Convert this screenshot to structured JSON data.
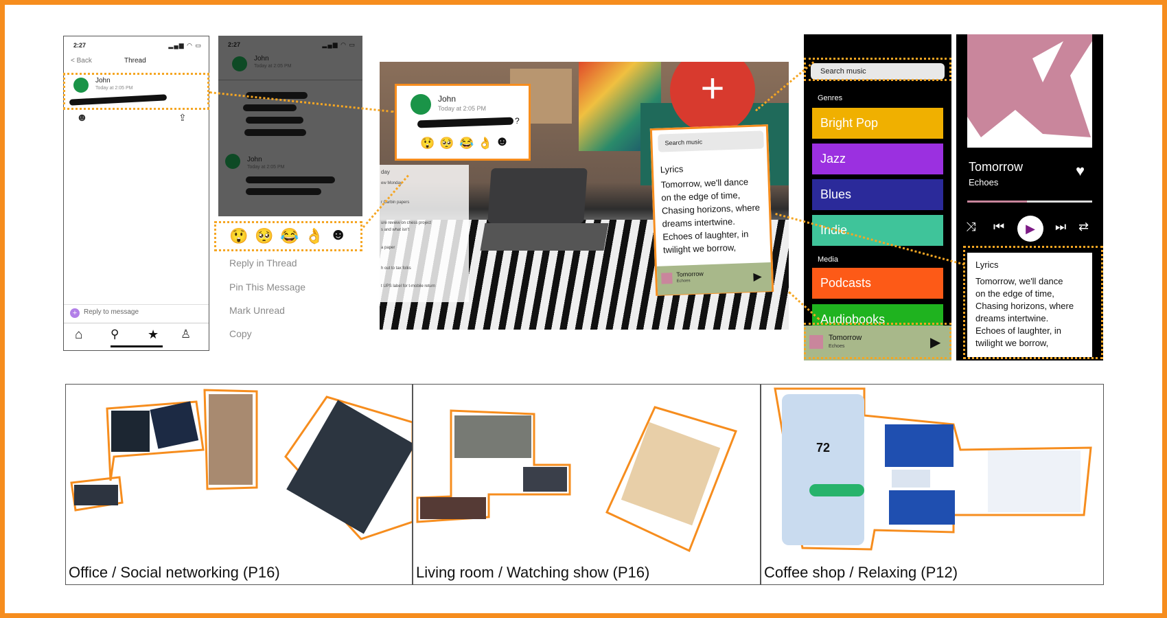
{
  "phone1": {
    "time": "2:27",
    "back": "< Back",
    "title": "Thread",
    "author": "John",
    "timestamp": "Today at 2:05 PM",
    "reply_placeholder": "Reply to message"
  },
  "phone2": {
    "time": "2:27",
    "msg1_author": "John",
    "msg1_time": "Today at 2:05 PM",
    "msg2_author": "John",
    "msg2_time": "Today at 2:05 PM",
    "emojis": [
      "😲",
      "🥺",
      "😂",
      "👌"
    ],
    "menu": [
      "Reply in Thread",
      "Pin This Message",
      "Mark Unread",
      "Copy"
    ]
  },
  "ar_popup": {
    "author": "John",
    "timestamp": "Today at 2:05 PM",
    "message_tail": "?",
    "emojis": [
      "😲",
      "🥺",
      "😂",
      "👌"
    ]
  },
  "ar_music": {
    "search": "Search music",
    "lyrics_title": "Lyrics",
    "lyrics": [
      "Tomorrow, we'll dance",
      "on the edge of time,",
      "Chasing horizons, where",
      "dreams intertwine.",
      "Echoes of laughter, in",
      "twilight we borrow,"
    ],
    "track": "Tomorrow",
    "artist": "Echoes"
  },
  "ar_laptop_list": {
    "items": [
      "day",
      "ew Monday",
      "r Carbin papers",
      "ure review on chess project",
      "s and what isn't",
      "a paper",
      "h out to tax folks",
      "t UPS label for t-mobile return"
    ]
  },
  "music_app": {
    "search": "Search music",
    "genres_label": "Genres",
    "genres": [
      {
        "label": "Bright Pop",
        "color": "#f0b000"
      },
      {
        "label": "Jazz",
        "color": "#9b30e0"
      },
      {
        "label": "Blues",
        "color": "#2b2a9a"
      },
      {
        "label": "Indie",
        "color": "#3fc49a"
      }
    ],
    "media_label": "Media",
    "media": [
      {
        "label": "Podcasts",
        "color": "#fd5a17"
      },
      {
        "label": "Audiobooks",
        "color": "#1fb31f"
      }
    ],
    "mini_track": "Tomorrow",
    "mini_artist": "Echoes"
  },
  "player": {
    "track": "Tomorrow",
    "artist": "Echoes",
    "progress": 0.48,
    "lyrics_title": "Lyrics",
    "lyrics": [
      "Tomorrow, we'll dance",
      "on the edge of time,",
      "Chasing horizons, where",
      "dreams intertwine.",
      "Echoes of laughter, in",
      "twilight we borrow,"
    ],
    "accent": "#c9869c"
  },
  "panels": [
    {
      "caption": "Office / Social networking (P16)"
    },
    {
      "caption": "Living room / Watching show (P16)"
    },
    {
      "caption": "Coffee shop / Relaxing (P12)"
    }
  ],
  "weather": {
    "temp": "72"
  },
  "colors": {
    "border": "#f68d1e",
    "highlight": "#f5a623"
  }
}
